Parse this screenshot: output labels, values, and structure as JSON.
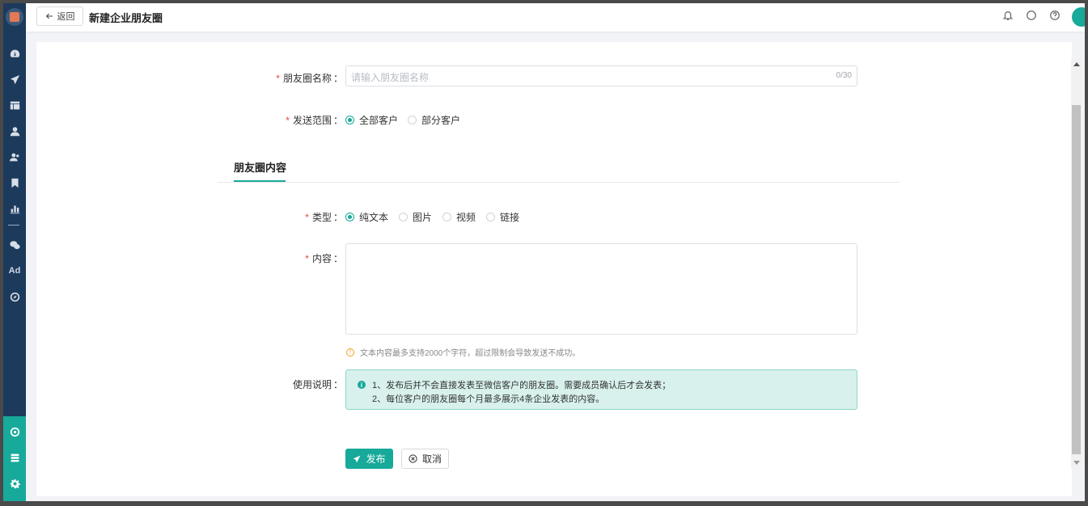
{
  "header": {
    "back_label": "返回",
    "title": "新建企业朋友圈"
  },
  "form": {
    "name_label": "朋友圈名称",
    "name_placeholder": "请输入朋友圈名称",
    "name_count": "0/30",
    "scope_label": "发送范围",
    "scope_options": [
      "全部客户",
      "部分客户"
    ],
    "scope_selected": "全部客户",
    "section_tab": "朋友圈内容",
    "type_label": "类型",
    "type_options": [
      "纯文本",
      "图片",
      "视频",
      "链接"
    ],
    "type_selected": "纯文本",
    "content_label": "内容",
    "content_hint": "文本内容最多支持2000个字符，超过限制会导致发送不成功。",
    "usage_label": "使用说明",
    "usage_lines": [
      "1、发布后并不会直接发表至微信客户的朋友圈。需要成员确认后才会发表；",
      "2、每位客户的朋友圈每个月最多展示4条企业发表的内容。"
    ],
    "colon": "："
  },
  "actions": {
    "publish_label": "发布",
    "cancel_label": "取消"
  },
  "colors": {
    "accent": "#17a99a",
    "sidebar": "#1c3a5c",
    "required": "#e24b3b"
  },
  "sidebar": {
    "items": [
      "dashboard-icon",
      "send-icon",
      "table-icon",
      "user-icon",
      "users-icon",
      "bookmark-icon",
      "bar-chart-icon",
      "wechat-icon",
      "ad-icon",
      "compass-icon"
    ],
    "ad_text": "Ad",
    "bottom_items": [
      "target-icon",
      "layers-icon",
      "gear-icon"
    ]
  }
}
